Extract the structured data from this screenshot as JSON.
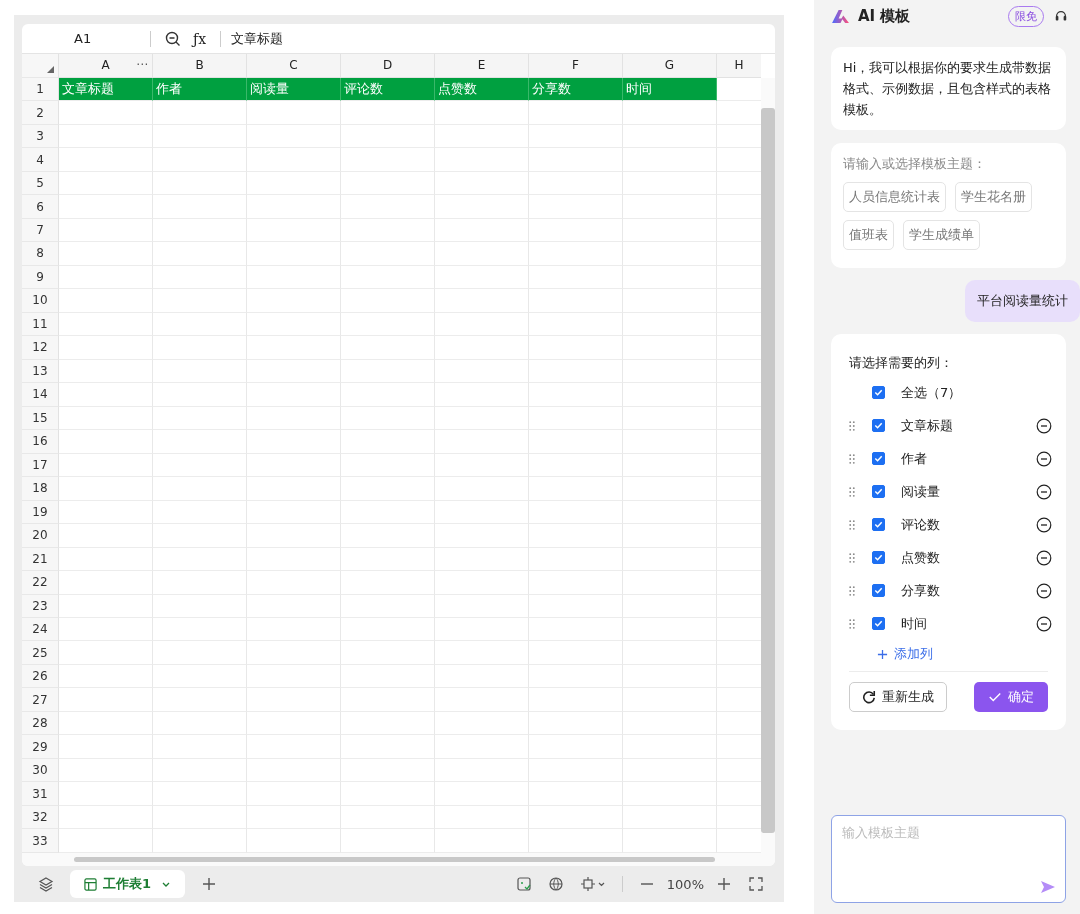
{
  "formula_bar": {
    "cell_ref": "A1",
    "function_label": "ƒx",
    "formula": "文章标题"
  },
  "sheet": {
    "columns": [
      "A",
      "B",
      "C",
      "D",
      "E",
      "F",
      "G",
      "H"
    ],
    "column_menu": "⋯",
    "header_row": [
      "文章标题",
      "作者",
      "阅读量",
      "评论数",
      "点赞数",
      "分享数",
      "时间"
    ],
    "row_labels": [
      "1",
      "2",
      "3",
      "4",
      "5",
      "6",
      "7",
      "8",
      "9",
      "10",
      "11",
      "12",
      "13",
      "14",
      "15",
      "16",
      "17",
      "18",
      "19",
      "20",
      "21",
      "22",
      "23",
      "24",
      "25",
      "26",
      "27",
      "28",
      "29",
      "30",
      "31",
      "32",
      "33"
    ]
  },
  "bottom_bar": {
    "tabs": [
      {
        "label": "工作表1",
        "selected": true
      }
    ],
    "zoom": "100%"
  },
  "assistant": {
    "title": "AI 模板",
    "badge": "限免",
    "greeting": "Hi，我可以根据你的要求生成带数据格式、示例数据，且包含样式的表格模板。",
    "topic_prompt": "请输入或选择模板主题：",
    "suggestions": [
      [
        "人员信息统计表",
        "学生花名册"
      ],
      [
        "值班表",
        "学生成绩单"
      ]
    ],
    "user_message": "平台阅读量统计",
    "column_picker": {
      "prompt": "请选择需要的列：",
      "select_all": {
        "label": "全选（7）",
        "checked": true
      },
      "items": [
        {
          "label": "文章标题",
          "checked": true
        },
        {
          "label": "作者",
          "checked": true
        },
        {
          "label": "阅读量",
          "checked": true
        },
        {
          "label": "评论数",
          "checked": true
        },
        {
          "label": "点赞数",
          "checked": true
        },
        {
          "label": "分享数",
          "checked": true
        },
        {
          "label": "时间",
          "checked": true
        }
      ],
      "add_label": "添加列",
      "regenerate": "重新生成",
      "confirm": "确定"
    },
    "input": {
      "placeholder": "输入模板主题"
    }
  }
}
